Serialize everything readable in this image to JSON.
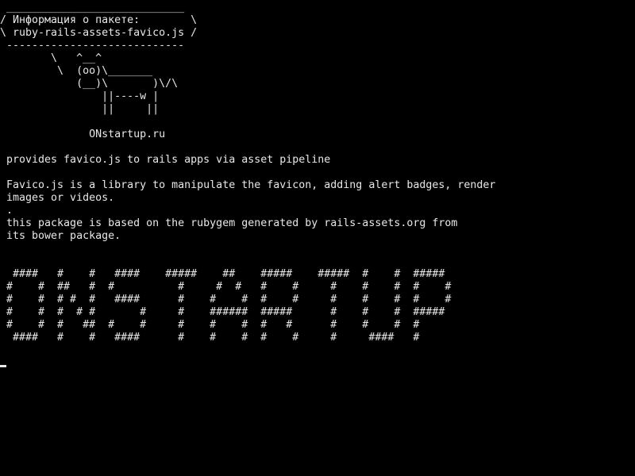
{
  "screen": {
    "background_color": "#000000",
    "text_color": "#e8e8e8"
  },
  "cowsay": {
    "bubble": [
      " ____________________________",
      "/ Информация о пакете:        \\",
      "\\ ruby-rails-assets-favico.js /",
      " ----------------------------"
    ],
    "cow": [
      "        \\   ^__^",
      "         \\  (oo)\\_______",
      "            (__)\\       )\\/\\",
      "                ||----w |",
      "                ||     ||"
    ],
    "site": "              ONstartup.ru"
  },
  "description": {
    "summary": " provides favico.js to rails apps via asset pipeline",
    "details": [
      " Favico.js is a library to manipulate the favicon, adding alert badges, render",
      " images or videos.",
      " .",
      " this package is based on the rubygem generated by rails-assets.org from",
      " its bower package."
    ]
  },
  "banner": [
    "  ####   #    #   ####    #####    ##    #####    #####  #    #  #####",
    " #    #  ##   #  #          #     #  #   #    #     #    #    #  #    #",
    " #    #  # #  #   ####      #    #    #  #    #     #    #    #  #    #",
    " #    #  #  # #       #     #    ######  #####      #    #    #  #####",
    " #    #  #   ##  #    #     #    #    #  #   #      #    #    #  #",
    "  ####   #    #   ####      #    #    #  #    #     #     ####   #"
  ],
  "prompt": {
    "cursor": "block-cursor"
  }
}
